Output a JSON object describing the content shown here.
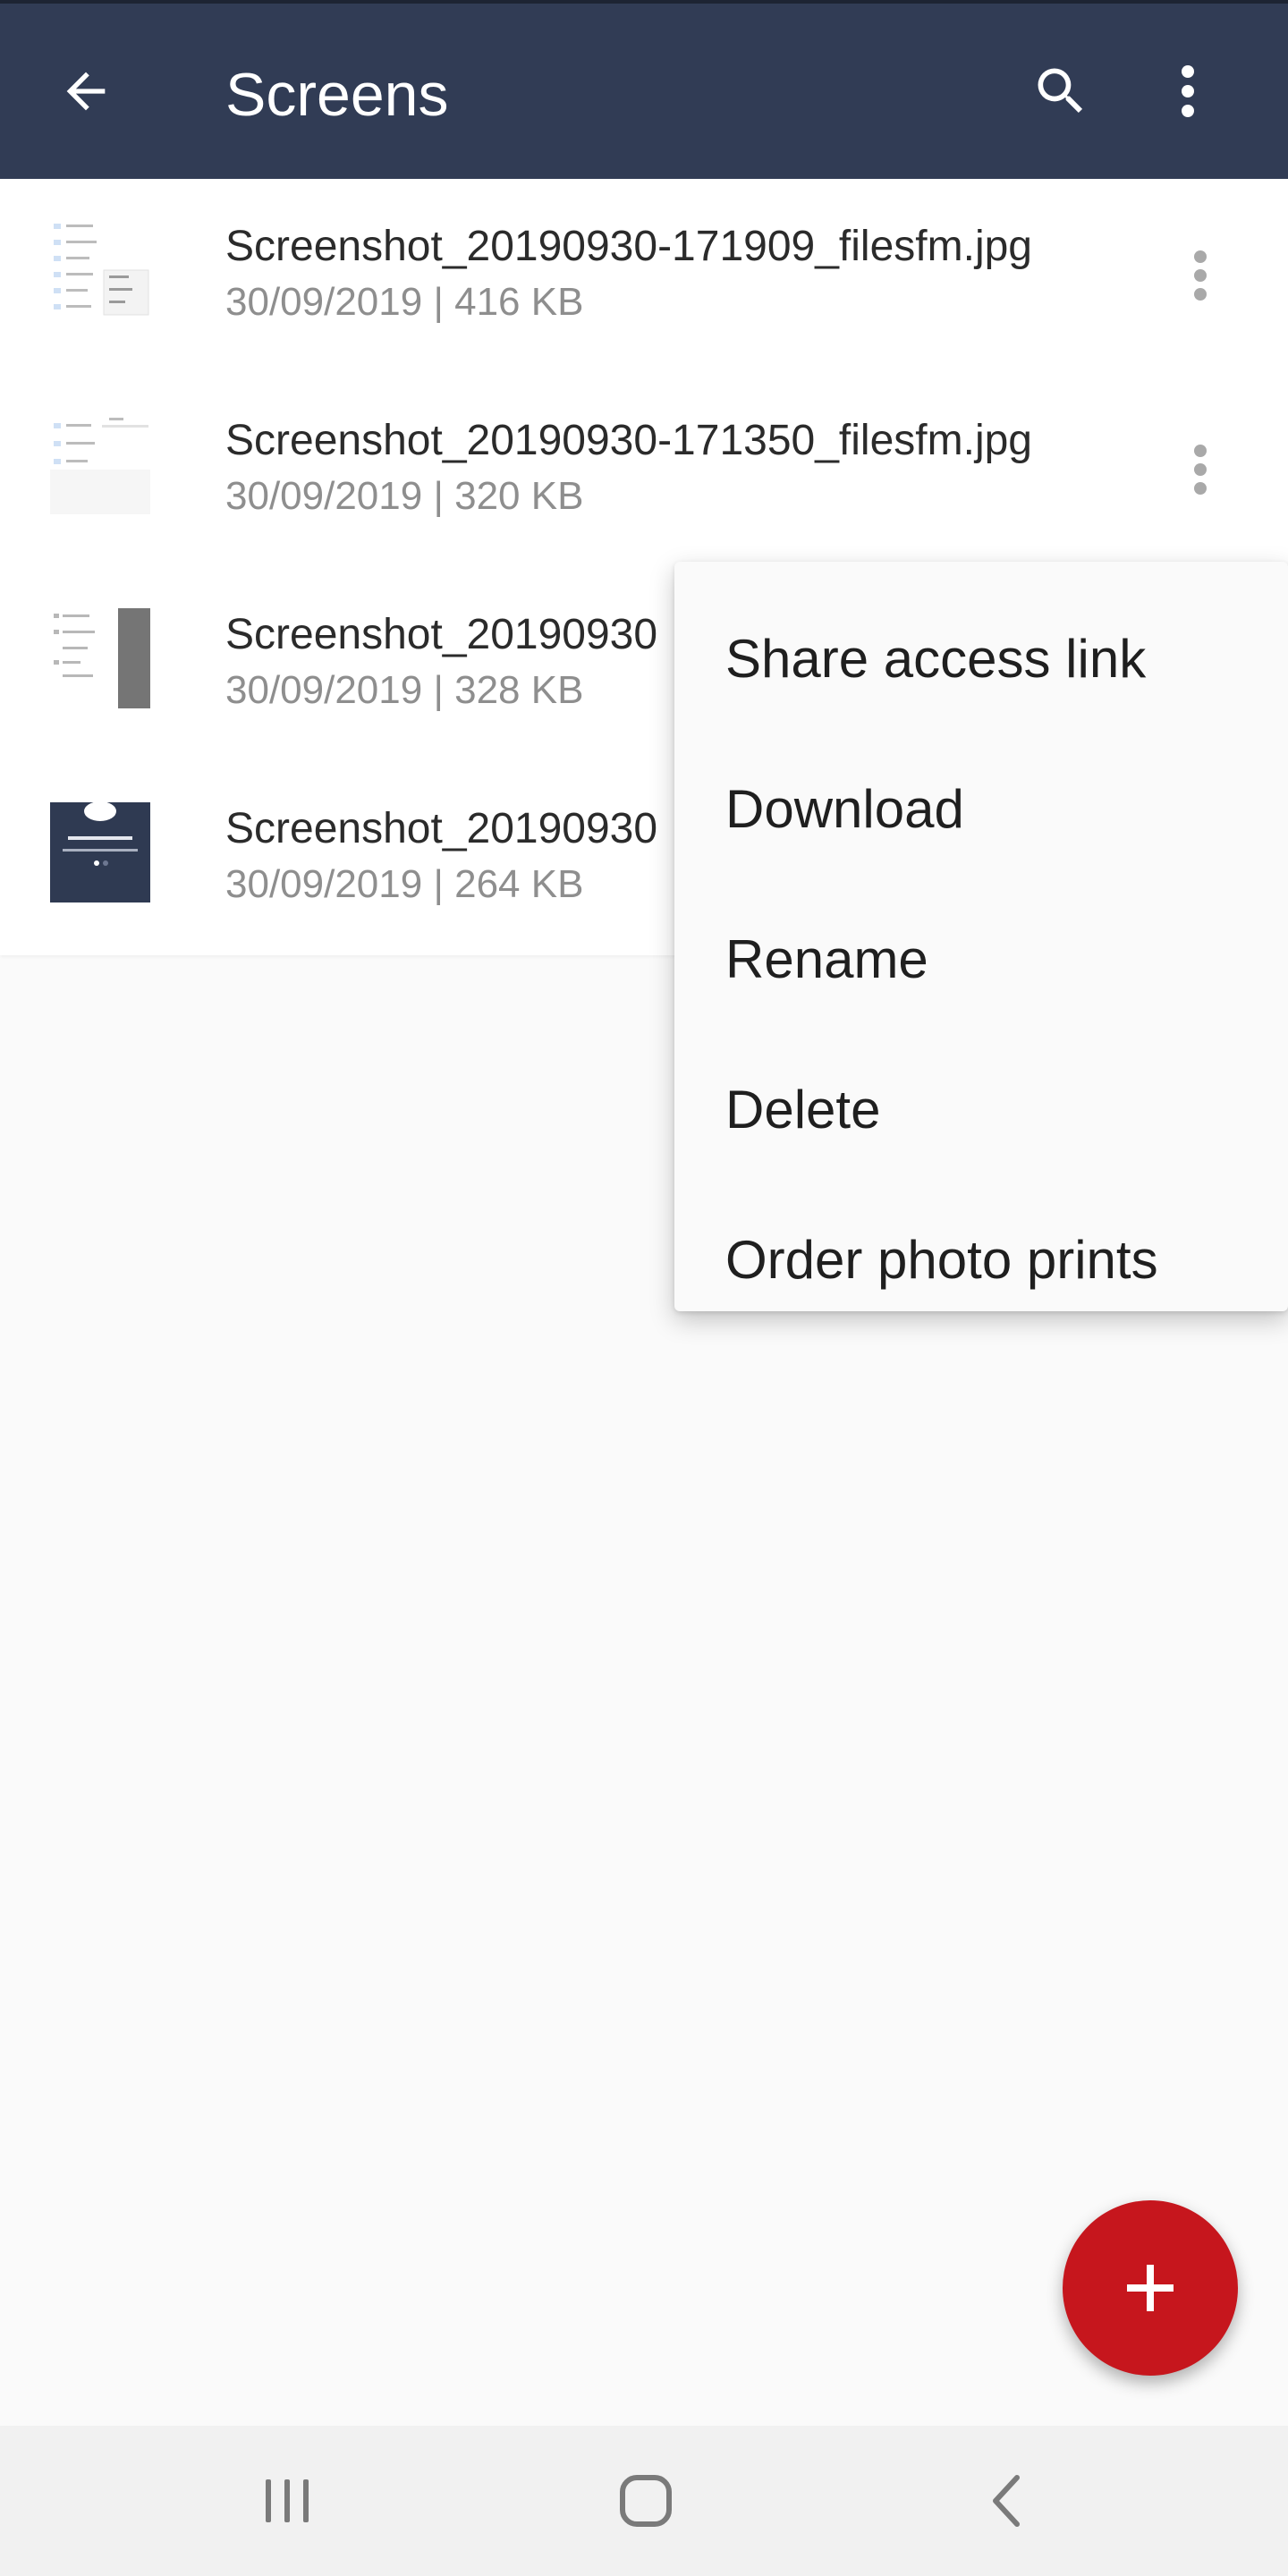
{
  "app_bar": {
    "title": "Screens",
    "back_icon": "arrow-left-icon",
    "search_icon": "search-icon",
    "more_icon": "more-vertical-icon",
    "background": "#313c55"
  },
  "files": [
    {
      "name": "Screenshot_20190930-171909_filesfm.jpg",
      "meta": "30/09/2019 | 416 KB",
      "thumb": "light-list-screenshot"
    },
    {
      "name": "Screenshot_20190930-171350_filesfm.jpg",
      "meta": "30/09/2019 | 320 KB",
      "thumb": "light-list-screenshot"
    },
    {
      "name": "Screenshot_20190930",
      "meta": "30/09/2019 | 328 KB",
      "thumb": "menu-screenshot"
    },
    {
      "name": "Screenshot_20190930",
      "meta": "30/09/2019 | 264 KB",
      "thumb": "dark-cloud-screenshot"
    }
  ],
  "context_menu": {
    "items": [
      "Share access link",
      "Download",
      "Rename",
      "Delete",
      "Order photo prints"
    ]
  },
  "fab": {
    "icon": "plus-icon",
    "color": "#c6161d"
  },
  "nav_bar": {
    "recents_icon": "recents-icon",
    "home_icon": "home-icon",
    "back_icon": "chevron-left-icon"
  }
}
